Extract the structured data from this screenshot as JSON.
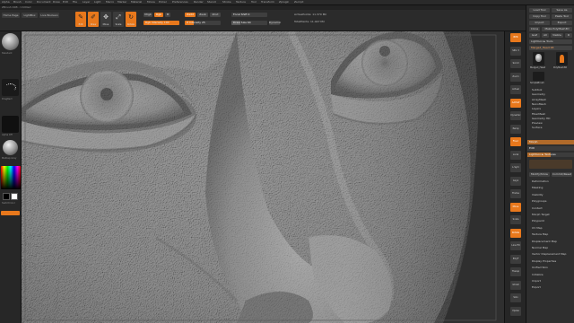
{
  "app": {
    "menu": [
      "Alpha",
      "Brush",
      "Color",
      "Document",
      "Draw",
      "Edit",
      "File",
      "Layer",
      "Light",
      "Macro",
      "Marker",
      "Material",
      "Movie",
      "Picker",
      "Preferences",
      "Render",
      "Stencil",
      "Stroke",
      "Texture",
      "Tool",
      "Transform",
      "Zplugin",
      "Zscript"
    ],
    "document_title": "ZBrush 4R8 - Untitled"
  },
  "toolbar": {
    "home_page": "Home Page",
    "lightbox": "LightBox",
    "live_boolean": "Live Boolean",
    "edit": "Edit",
    "draw": "Draw",
    "move": "Move",
    "scale": "Scale",
    "rotate": "Rotate",
    "mrgb": "Mrgb",
    "rgb": "Rgb",
    "m": "M",
    "zadd": "Zadd",
    "zsub": "Zsub",
    "zcut": "Zcut",
    "rgb_intensity": "Rgb Intensity 100",
    "z_intensity": "Z Intensity 25",
    "focal_shift": "Focal Shift 0",
    "draw_size": "Draw Size 64",
    "dynamic": "Dynamic",
    "active_points": "ActivePoints: 11.370 Mil",
    "total_points": "TotalPoints: 11.447 Mil",
    "rgb_intensity_value": 100,
    "z_intensity_value": 25,
    "draw_size_value": 64
  },
  "left_shelf": {
    "brush_label": "Standard",
    "stroke_label": "DragRect",
    "alpha_label": "Alpha Off",
    "texture_label": "Texture Off",
    "material_label": "MatCap Gray",
    "gradient_label": "Gradient",
    "switch_color": "SwitchColor",
    "alternate": "Alternate"
  },
  "right_shelf": {
    "buttons": [
      "BPR",
      "SPix 3",
      "Scroll",
      "Zoom",
      "Actual",
      "AAHalf",
      "Dynamic",
      "Persp",
      "Floor",
      "Local",
      "L.Sym",
      "Gxyz",
      "Frame",
      "Move",
      "Scale",
      "Rotate",
      "Line Fill",
      "PolyF",
      "Transp",
      "Ghost",
      "Solo",
      "Xpose"
    ]
  },
  "tray": {
    "top_buttons": [
      "Load Tool",
      "Save As",
      "Copy Tool",
      "Paste Tool",
      "Import",
      "Export",
      "Clone",
      "Make PolyMesh3D",
      "GoZ",
      "All",
      "Visible",
      "R"
    ],
    "lightbox_tools": "Lightbox ► Tools",
    "current_tool": "Merged_Head 48",
    "tool_1": "Merged_Head",
    "tool_2": "PolyMesh3D",
    "tool_3": "SimpleBrush",
    "subtools": [
      "Subtool",
      "Geometry",
      "ArrayMesh",
      "NanoMesh",
      "Layers",
      "FiberMesh",
      "Geometry HD",
      "Preview",
      "Surface"
    ],
    "deformation_label": "Deformation",
    "morph_target": "Morph Target",
    "list2": [
      "Deformation",
      "Masking",
      "Visibility",
      "Polygroups",
      "Contact",
      "Morph Target",
      "Polypaint",
      "UV Map",
      "Texture Map",
      "Displacement Map",
      "Normal Map",
      "Vector Displacement Map",
      "Display Properties",
      "Unified Skin",
      "Initialize",
      "Import",
      "Export"
    ],
    "sliders": [
      {
        "label": "Morph",
        "value": 1
      },
      {
        "label": "Edit",
        "value": 0
      },
      {
        "label": "Lightbox ► Textures",
        "value": 0.5
      }
    ],
    "small_pair": [
      "Modify/Show",
      "Commit/Reset"
    ]
  },
  "viewport": {
    "model": "Merged_Head"
  },
  "colors": {
    "accent": "#e8781c",
    "panel": "#2b2b2b",
    "clay": "#8a8a8a"
  }
}
